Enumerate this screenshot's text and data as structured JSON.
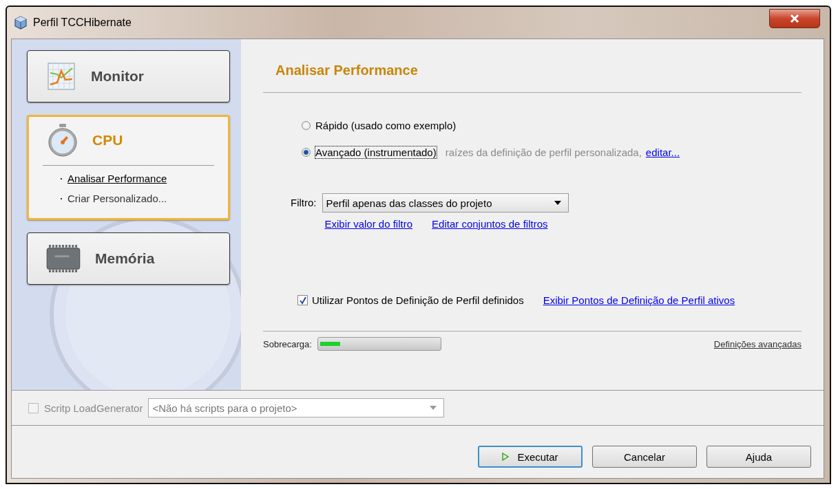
{
  "window": {
    "title": "Perfil TCCHibernate"
  },
  "categories": [
    {
      "label": "Monitor",
      "selected": false
    },
    {
      "label": "CPU",
      "selected": true,
      "items": [
        {
          "label": "Analisar Performance",
          "selected": true
        },
        {
          "label": "Criar Personalizado...",
          "selected": false
        }
      ]
    },
    {
      "label": "Memória",
      "selected": false
    }
  ],
  "heading": "Analisar Performance",
  "modes": [
    {
      "label": "Rápido (usado como exemplo)",
      "selected": false,
      "focused": false
    },
    {
      "label": "Avançado (instrumentado)",
      "selected": true,
      "focused": true,
      "note": "raízes da definição de perfil personalizada,",
      "link": "editar..."
    }
  ],
  "filter": {
    "label": "Filtro:",
    "value": "Perfil apenas das classes do projeto",
    "links": [
      "Exibir valor do filtro",
      "Editar conjuntos de filtros"
    ]
  },
  "profile_points": {
    "label": "Utilizar Pontos de Definição de Perfil definidos",
    "checked": true,
    "link": "Exibir Pontos de Definição de Perfil ativos"
  },
  "overhead": {
    "label": "Sobrecarga:",
    "level": 0.17,
    "link": "Definições avançadas"
  },
  "load_generator": {
    "label": "Scritp LoadGenerator",
    "checked": false,
    "disabled": true,
    "value": "<Não há scripts para o projeto>"
  },
  "buttons": [
    {
      "label": "Executar",
      "default": true
    },
    {
      "label": "Cancelar",
      "default": false
    },
    {
      "label": "Ajuda",
      "default": false
    }
  ]
}
